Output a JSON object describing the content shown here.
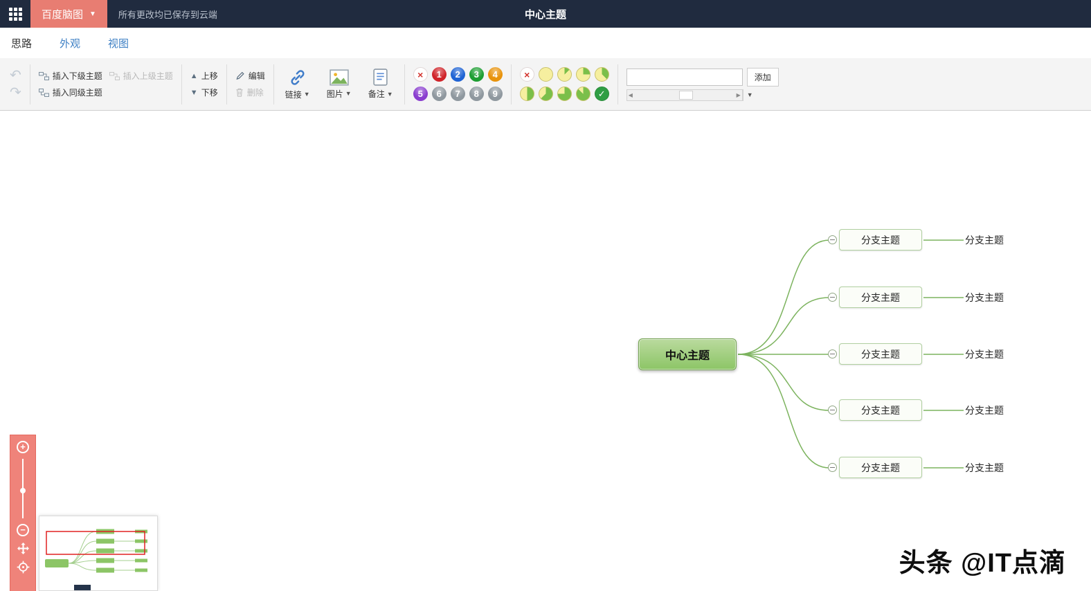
{
  "topbar": {
    "app_name": "百度脑图",
    "save_status": "所有更改均已保存到云端",
    "doc_title": "中心主题"
  },
  "tabs": {
    "idea": "思路",
    "appearance": "外观",
    "view": "视图"
  },
  "toolbar": {
    "insert_child": "插入下级主题",
    "insert_parent": "插入上级主题",
    "insert_sibling": "插入同级主题",
    "move_up": "上移",
    "move_down": "下移",
    "edit": "编辑",
    "delete": "删除",
    "link": "链接",
    "image": "图片",
    "note": "备注",
    "add_button": "添加",
    "tag_input_value": "",
    "priority": [
      "1",
      "2",
      "3",
      "4",
      "5",
      "6",
      "7",
      "8",
      "9"
    ]
  },
  "mindmap": {
    "root": "中心主题",
    "branches": [
      {
        "label": "分支主题",
        "child": "分支主题"
      },
      {
        "label": "分支主题",
        "child": "分支主题"
      },
      {
        "label": "分支主题",
        "child": "分支主题"
      },
      {
        "label": "分支主题",
        "child": "分支主题"
      },
      {
        "label": "分支主题",
        "child": "分支主题"
      }
    ]
  },
  "watermark": "头条 @IT点滴",
  "colors": {
    "topbar_bg": "#202b3f",
    "brand_red": "#e87d72",
    "tab_blue": "#3d7fc4",
    "branch_line_green": "#7cb35e",
    "root_fill_green": "#8cc566",
    "progress_yellow": "#f6ef9f",
    "progress_green": "#7bbf4a"
  }
}
